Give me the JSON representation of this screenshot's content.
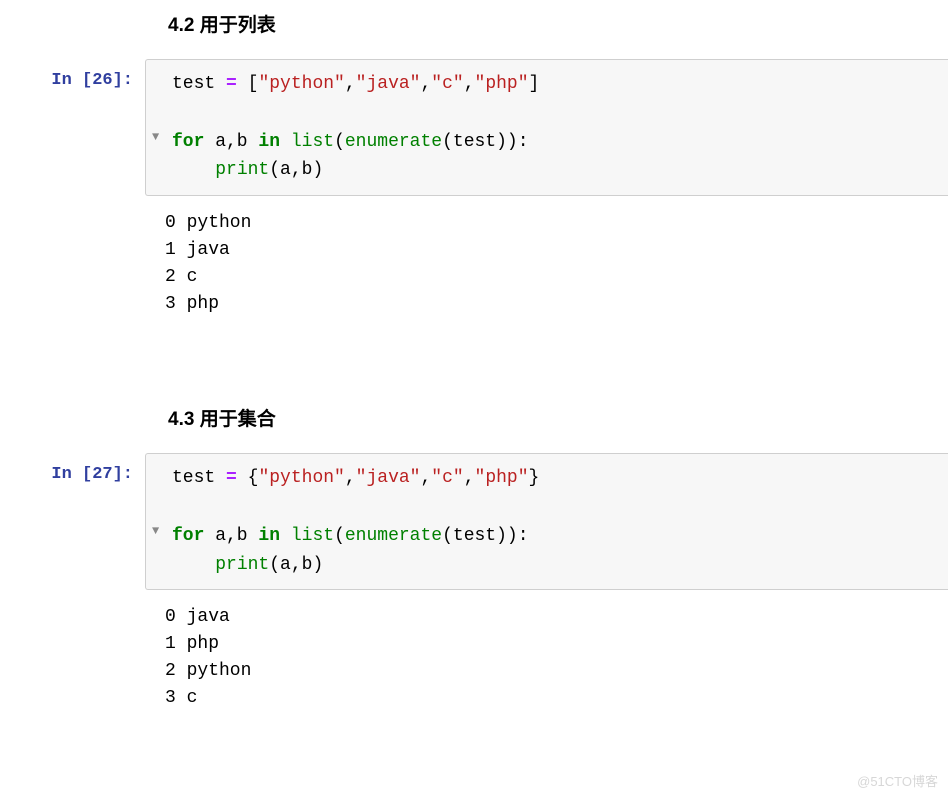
{
  "sections": [
    {
      "heading": "4.2  用于列表",
      "prompt_prefix": "In [",
      "prompt_number": "26",
      "prompt_suffix": "]:",
      "code": {
        "line1": {
          "s1": "test ",
          "op": "=",
          "s2": " [",
          "str1": "\"python\"",
          "c1": ",",
          "str2": "\"java\"",
          "c2": ",",
          "str3": "\"c\"",
          "c3": ",",
          "str4": "\"php\"",
          "s3": "]"
        },
        "line3": {
          "kw1": "for",
          "s1": " a,b ",
          "kw2": "in",
          "s2": " ",
          "builtin1": "list",
          "p1": "(",
          "builtin2": "enumerate",
          "p2": "(test)):"
        },
        "line4": {
          "indent": "    ",
          "builtin": "print",
          "args": "(a,b)"
        }
      },
      "output": "0 python\n1 java\n2 c\n3 php"
    },
    {
      "heading": "4.3  用于集合",
      "prompt_prefix": "In [",
      "prompt_number": "27",
      "prompt_suffix": "]:",
      "code": {
        "line1": {
          "s1": "test ",
          "op": "=",
          "s2": " {",
          "str1": "\"python\"",
          "c1": ",",
          "str2": "\"java\"",
          "c2": ",",
          "str3": "\"c\"",
          "c3": ",",
          "str4": "\"php\"",
          "s3": "}"
        },
        "line3": {
          "kw1": "for",
          "s1": " a,b ",
          "kw2": "in",
          "s2": " ",
          "builtin1": "list",
          "p1": "(",
          "builtin2": "enumerate",
          "p2": "(test)):"
        },
        "line4": {
          "indent": "    ",
          "builtin": "print",
          "args": "(a,b)"
        }
      },
      "output": "0 java\n1 php\n2 python\n3 c"
    }
  ],
  "watermark": "@51CTO博客",
  "fold_glyph": "▼"
}
